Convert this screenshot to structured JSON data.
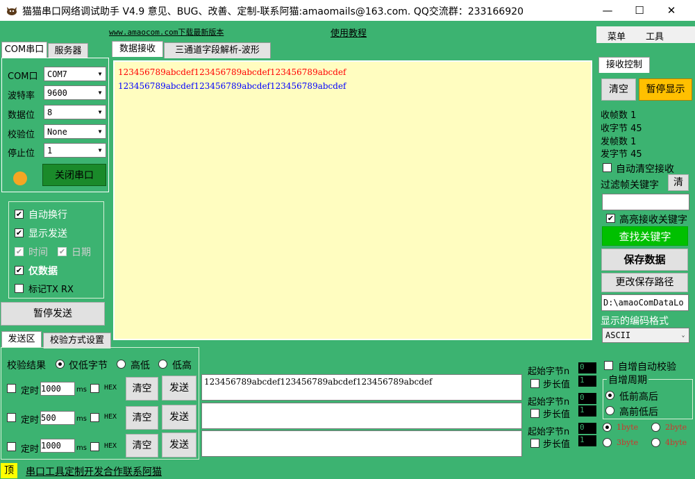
{
  "title": "猫猫串口网络调试助手 V4.9 意见、BUG、改善、定制-联系阿猫:amaomails@163.com. QQ交流群：233166920",
  "window_controls": {
    "minimize": "—",
    "maximize": "☐",
    "close": "✕"
  },
  "top_links": {
    "download": "www.amaocom.com下载最新版本",
    "tutorial": "使用教程"
  },
  "menu": {
    "menu": "菜单",
    "tools": "工具"
  },
  "left_tabs": {
    "com": "COM串口",
    "server": "服务器"
  },
  "serial": {
    "com_label": "COM口",
    "com_value": "COM7",
    "baud_label": "波特率",
    "baud_value": "9600",
    "data_label": "数据位",
    "data_value": "8",
    "parity_label": "校验位",
    "parity_value": "None",
    "stop_label": "停止位",
    "stop_value": "1",
    "close_port": "关闭串口",
    "indicator_color": "#f5a623"
  },
  "options": {
    "auto_newline": "自动换行",
    "show_send": "显示发送",
    "time": "时间",
    "date": "日期",
    "data_only": "仅数据",
    "mark_txrx": "标记TX RX"
  },
  "pause_send": "暂停发送",
  "bottom_tabs": {
    "send": "发送区",
    "checksum": "校验方式设置"
  },
  "receive_tabs": {
    "data": "数据接收",
    "three": "三通道字段解析-波形"
  },
  "receive_lines": [
    {
      "text": "123456789abcdef123456789abcdef123456789abcdef",
      "color": "#ff0000"
    },
    {
      "text": "123456789abcdef123456789abcdef123456789abcdef",
      "color": "#0000ff"
    }
  ],
  "recv_ctrl": {
    "tab": "接收控制",
    "clear": "清空",
    "pause_display": "暂停显示",
    "rx_frames": "收帧数 1",
    "rx_bytes": "收字节 45",
    "tx_frames": "发帧数 1",
    "tx_bytes": "发字节 45",
    "auto_clear": "自动清空接收",
    "filter_label": "过滤帧关键字",
    "filter_clear": "清",
    "highlight": "高亮接收关键字",
    "find": "查找关键字",
    "save": "保存数据",
    "change_path": "更改保存路径",
    "path": "D:\\amaoComDataLo",
    "encoding_label": "显示的编码格式",
    "encoding": "ASCII"
  },
  "checksum": {
    "result": "校验结果",
    "low_byte": "仅低字节",
    "high_low": "高低",
    "low_high": "低高"
  },
  "timers": [
    {
      "label": "定时",
      "value": "1000",
      "unit": "ms",
      "hex": "HEX",
      "clear": "清空",
      "send": "发送"
    },
    {
      "label": "定时",
      "value": "500",
      "unit": "ms",
      "hex": "HEX",
      "clear": "清空",
      "send": "发送"
    },
    {
      "label": "定时",
      "value": "1000",
      "unit": "ms",
      "hex": "HEX",
      "clear": "清空",
      "send": "发送"
    }
  ],
  "send_inputs": [
    "123456789abcdef123456789abcdef123456789abcdef",
    "",
    ""
  ],
  "increments": [
    {
      "start": "起始字节n",
      "start_val": "0",
      "step": "步长值",
      "step_val": "1"
    },
    {
      "start": "起始字节n",
      "start_val": "0",
      "step": "步长值",
      "step_val": "1"
    },
    {
      "start": "起始字节n",
      "start_val": "0",
      "step": "步长值",
      "step_val": "1"
    }
  ],
  "auto_check": "自增自动校验",
  "auto_period": "自增周期",
  "order": {
    "low_first": "低前高后",
    "high_first": "高前低后"
  },
  "bytes": {
    "b1": "1byte",
    "b2": "2byte",
    "b3": "3byte",
    "b4": "4byte"
  },
  "footer": {
    "pin": "顶",
    "link": "串口工具定制开发合作联系阿猫"
  }
}
